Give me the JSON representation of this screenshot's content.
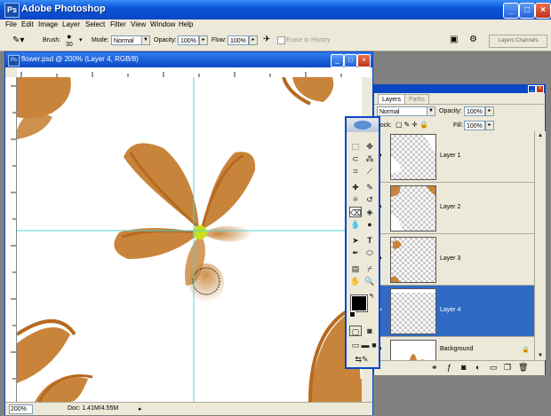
{
  "app": {
    "title": "Adobe Photoshop",
    "icon": "photoshop-icon"
  },
  "menu": [
    "File",
    "Edit",
    "Image",
    "Layer",
    "Select",
    "Filter",
    "View",
    "Window",
    "Help"
  ],
  "options": {
    "brush_label": "Brush:",
    "brush_size": "30",
    "mode_label": "Mode:",
    "mode_value": "Normal",
    "opacity_label": "Opacity:",
    "opacity_value": "100%",
    "flow_label": "Flow:",
    "flow_value": "100%",
    "erase_history": "Erase to History",
    "palette_well": "Layers  Channels"
  },
  "document": {
    "title": "flower.psd @ 200% (Layer 4, RGB/8)",
    "zoom": "200%",
    "status": "Doc: 1.41M/4.55M",
    "guide_color": "#4fd3d8",
    "petal_color": "#c8843a",
    "petal_outline": "#b8691f",
    "center_color": "#c8e020"
  },
  "layers": {
    "tabs": [
      "Layers",
      "Paths"
    ],
    "blend_mode": "Normal",
    "opacity_label": "Opacity:",
    "opacity_value": "100%",
    "lock_label": "Lock:",
    "fill_label": "Fill:",
    "fill_value": "100%",
    "items": [
      {
        "name": "Layer 1",
        "selected": false
      },
      {
        "name": "Layer 2",
        "selected": false
      },
      {
        "name": "Layer 3",
        "selected": false
      },
      {
        "name": "Layer 4",
        "selected": true
      },
      {
        "name": "Background",
        "selected": false
      }
    ],
    "selection_color": "#316ac5"
  }
}
